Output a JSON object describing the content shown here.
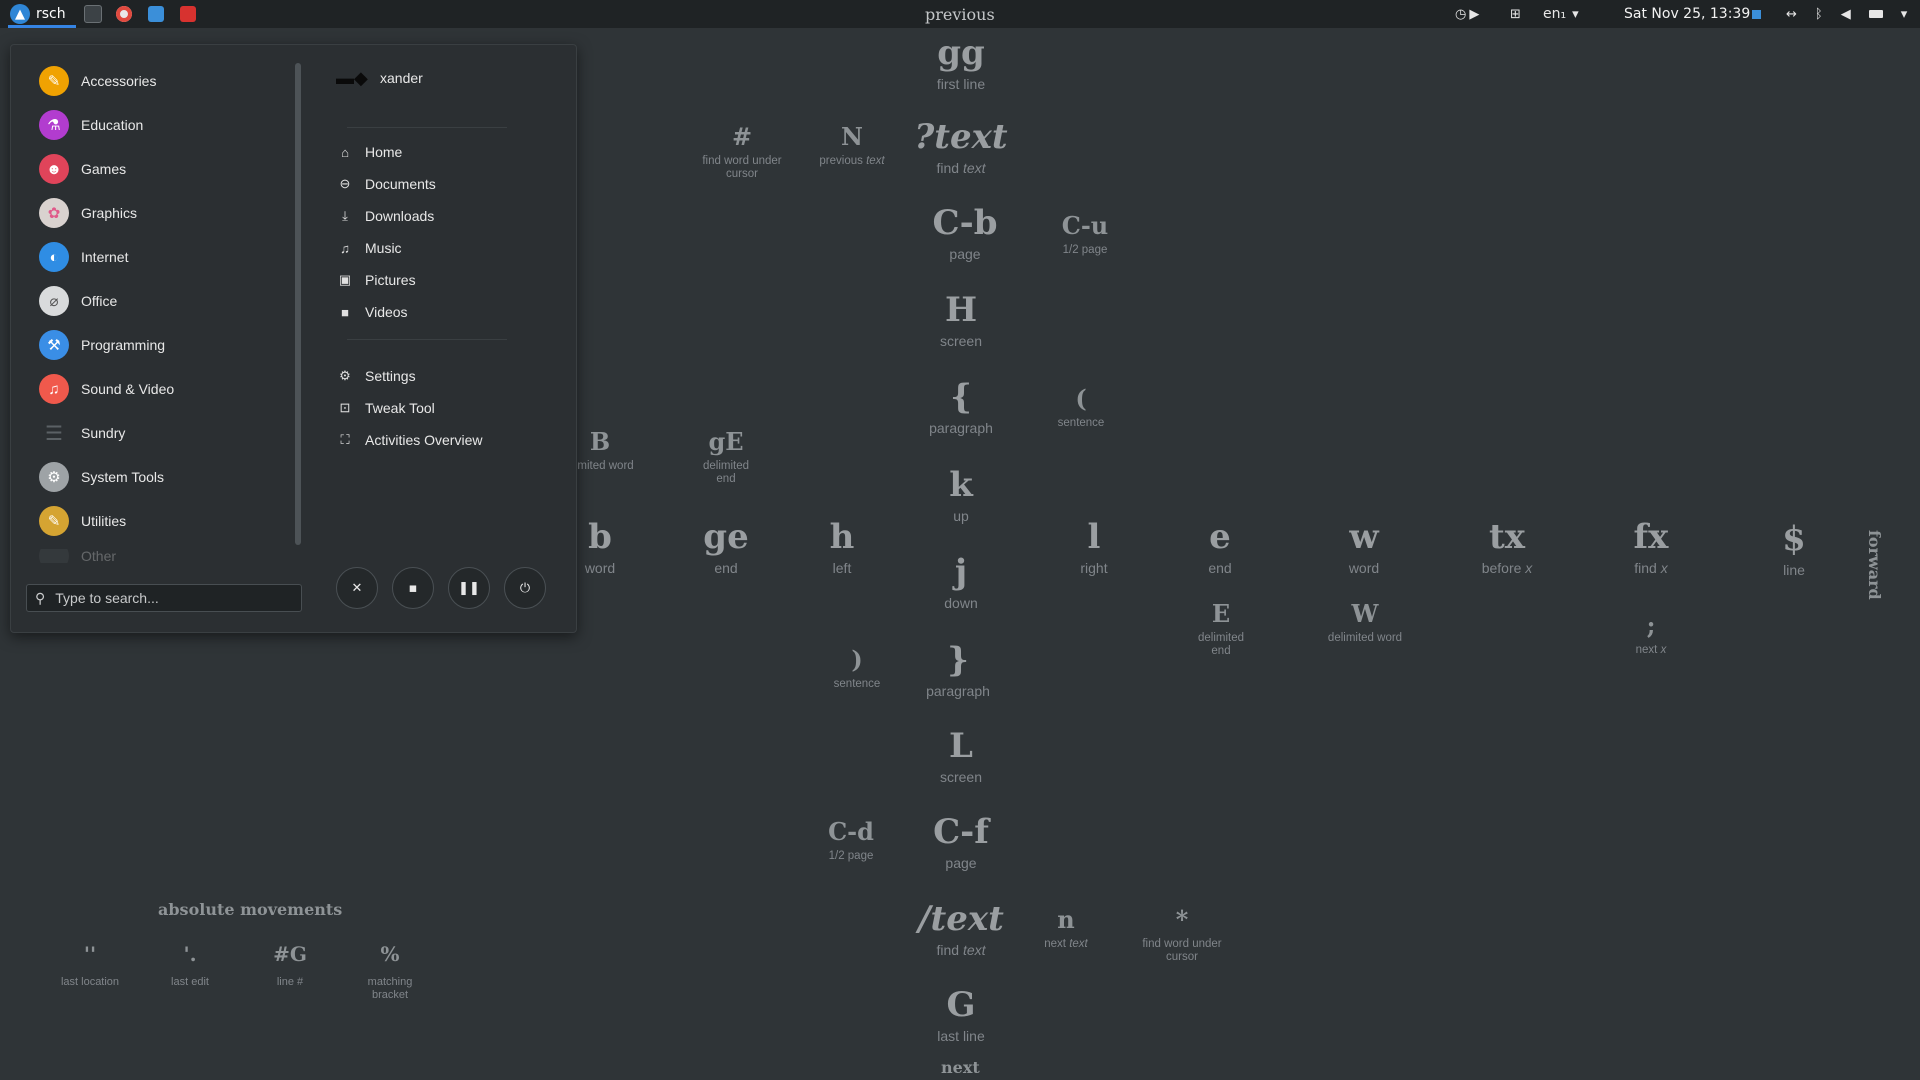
{
  "topbar": {
    "activities": "rsch",
    "window_title": "previous",
    "keyboard_layout": "en₁",
    "clock": "Sat Nov 25, 13:39",
    "colors": {
      "accent": "#3584e4",
      "panel": "#1f2325"
    }
  },
  "wallpaper": {
    "top_label": "previous",
    "bottom_label": "next",
    "side_label": "forward",
    "keys": [
      {
        "key": "gg",
        "desc": "first line"
      },
      {
        "key": "#",
        "desc": "find word under cursor"
      },
      {
        "key": "N",
        "desc": "previous",
        "desc_em": "text"
      },
      {
        "key": "?text",
        "desc": "find",
        "desc_em": "text"
      },
      {
        "key": "C-b",
        "desc": "page"
      },
      {
        "key": "C-u",
        "desc": "1/2 page"
      },
      {
        "key": "H",
        "desc": "screen"
      },
      {
        "key": "{",
        "desc": "paragraph"
      },
      {
        "key": "(",
        "desc": "sentence"
      },
      {
        "key": "B",
        "desc": "limited word"
      },
      {
        "key": "gE",
        "desc": "delimited end"
      },
      {
        "key": "k",
        "desc": "up"
      },
      {
        "key": "b",
        "desc": "word"
      },
      {
        "key": "ge",
        "desc": "end"
      },
      {
        "key": "h",
        "desc": "left"
      },
      {
        "key": "l",
        "desc": "right"
      },
      {
        "key": "e",
        "desc": "end"
      },
      {
        "key": "w",
        "desc": "word"
      },
      {
        "key": "tx",
        "desc": "before",
        "desc_em": "x"
      },
      {
        "key": "fx",
        "desc": "find",
        "desc_em": "x"
      },
      {
        "key": "$",
        "desc": "line"
      },
      {
        "key": "j",
        "desc": "down"
      },
      {
        "key": "E",
        "desc": "delimited end"
      },
      {
        "key": "W",
        "desc": "delimited word"
      },
      {
        "key": ";",
        "desc": "next",
        "desc_em": "x"
      },
      {
        "key": ")",
        "desc": "sentence"
      },
      {
        "key": "}",
        "desc": "paragraph"
      },
      {
        "key": "L",
        "desc": "screen"
      },
      {
        "key": "C-d",
        "desc": "1/2 page"
      },
      {
        "key": "C-f",
        "desc": "page"
      },
      {
        "key": "/text",
        "desc": "find",
        "desc_em": "text"
      },
      {
        "key": "n",
        "desc": "next",
        "desc_em": "text"
      },
      {
        "key": "*",
        "desc": "find word under cursor"
      },
      {
        "key": "G",
        "desc": "last line"
      }
    ],
    "absolute": {
      "title": "absolute movements",
      "items": [
        {
          "key": "''",
          "desc": "last location"
        },
        {
          "key": "'.",
          "desc": "last edit"
        },
        {
          "key": "#G",
          "desc": "line #"
        },
        {
          "key": "%",
          "desc": "matching bracket"
        }
      ]
    }
  },
  "menu": {
    "categories": [
      {
        "label": "Accessories",
        "icon": "accessories-icon",
        "color": "#f0a202"
      },
      {
        "label": "Education",
        "icon": "education-icon",
        "color": "#b23ccf"
      },
      {
        "label": "Games",
        "icon": "games-icon",
        "color": "#e0445a"
      },
      {
        "label": "Graphics",
        "icon": "graphics-icon",
        "color": "#d9d2cf"
      },
      {
        "label": "Internet",
        "icon": "internet-icon",
        "color": "#2f8de4"
      },
      {
        "label": "Office",
        "icon": "office-icon",
        "color": "#d9dbdc"
      },
      {
        "label": "Programming",
        "icon": "programming-icon",
        "color": "#3a8ee6"
      },
      {
        "label": "Sound & Video",
        "icon": "sound-video-icon",
        "color": "#f0594c"
      },
      {
        "label": "Sundry",
        "icon": "sundry-icon",
        "color": "#5b6165"
      },
      {
        "label": "System Tools",
        "icon": "system-tools-icon",
        "color": "#9ea3a6"
      },
      {
        "label": "Utilities",
        "icon": "utilities-icon",
        "color": "#d5a432"
      },
      {
        "label": "Other",
        "icon": "other-icon",
        "color": "#4b5054"
      }
    ],
    "user": "xander",
    "places": [
      {
        "label": "Home",
        "icon": "home-icon"
      },
      {
        "label": "Documents",
        "icon": "documents-icon"
      },
      {
        "label": "Downloads",
        "icon": "downloads-icon"
      },
      {
        "label": "Music",
        "icon": "music-icon"
      },
      {
        "label": "Pictures",
        "icon": "pictures-icon"
      },
      {
        "label": "Videos",
        "icon": "videos-icon"
      }
    ],
    "apps": [
      {
        "label": "Settings",
        "icon": "settings-icon"
      },
      {
        "label": "Tweak Tool",
        "icon": "tweak-tool-icon"
      },
      {
        "label": "Activities Overview",
        "icon": "activities-overview-icon"
      }
    ],
    "search_placeholder": "Type to search..."
  }
}
